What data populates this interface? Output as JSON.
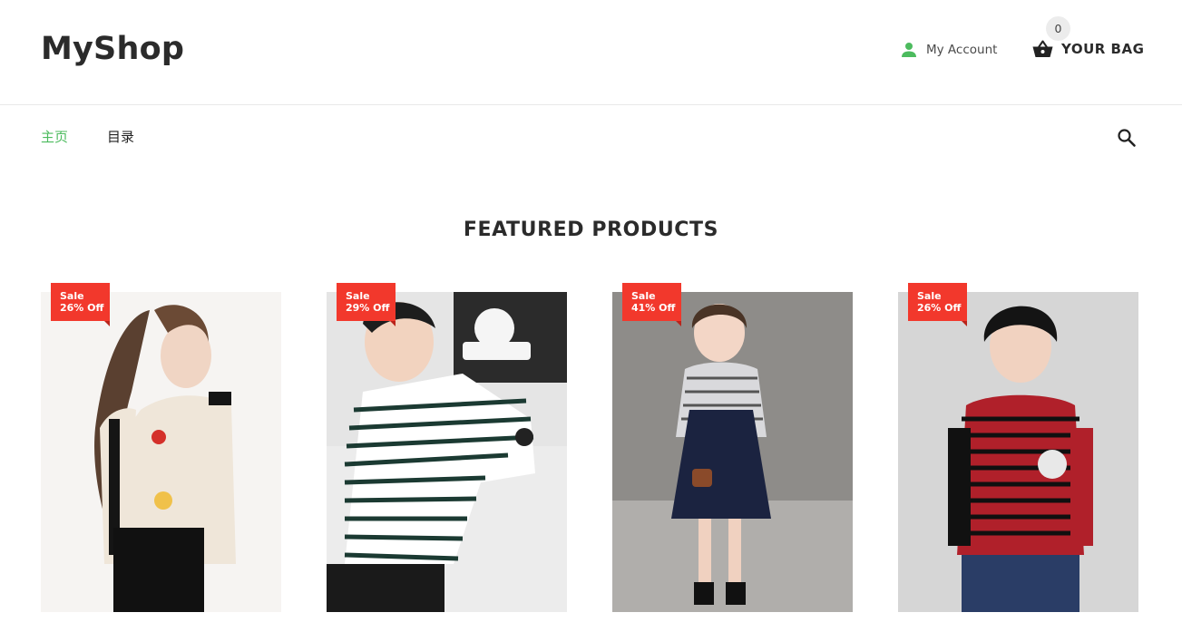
{
  "header": {
    "logo": "MyShop",
    "account_label": "My Account",
    "bag_label": "YOUR BAG",
    "bag_count": "0"
  },
  "nav": {
    "items": [
      {
        "label": "主页",
        "active": true
      },
      {
        "label": "目录",
        "active": false
      }
    ]
  },
  "main": {
    "section_title": "FEATURED PRODUCTS",
    "products": [
      {
        "sale_label": "Sale",
        "discount": "26% Off"
      },
      {
        "sale_label": "Sale",
        "discount": "29% Off"
      },
      {
        "sale_label": "Sale",
        "discount": "41% Off"
      },
      {
        "sale_label": "Sale",
        "discount": "26% Off"
      }
    ]
  },
  "colors": {
    "accent": "#4cbb5e",
    "sale_badge": "#f2382c",
    "text_dark": "#2b2b2b"
  },
  "icons": [
    "user-icon",
    "shopping-basket-icon",
    "search-icon"
  ]
}
